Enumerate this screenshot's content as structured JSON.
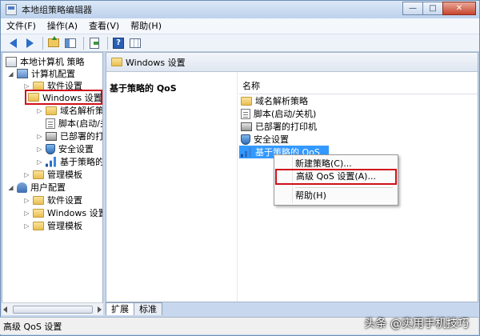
{
  "window": {
    "title": "本地组策略编辑器",
    "minimize": "—",
    "maximize": "□",
    "close": "✕"
  },
  "menu": [
    "文件(F)",
    "操作(A)",
    "查看(V)",
    "帮助(H)"
  ],
  "tree": {
    "root": "本地计算机 策略",
    "computer_config": "计算机配置",
    "software_settings": "软件设置",
    "windows_settings": "Windows 设置",
    "dns_policy": "域名解析策略",
    "scripts": "脚本(启动/关",
    "printers": "已部署的打印",
    "security": "安全设置",
    "qos": "基于策略的 C",
    "admin_templates": "管理模板",
    "user_config": "用户配置",
    "user_software": "软件设置",
    "user_windows": "Windows 设置",
    "user_admin_templates": "管理模板"
  },
  "right_pane": {
    "header": "Windows 设置",
    "left_title": "基于策略的 QoS",
    "column_name": "名称",
    "items": [
      "域名解析策略",
      "脚本(启动/关机)",
      "已部署的打印机",
      "安全设置",
      "基于策略的 QoS"
    ]
  },
  "context_menu": {
    "new_policy": "新建策略(C)...",
    "advanced_qos": "高级 QoS 设置(A)...",
    "help": "帮助(H)"
  },
  "tabs": [
    "扩展",
    "标准"
  ],
  "status": "高级 QoS 设置",
  "watermark": "头条 @实用手机技巧",
  "colors": {
    "highlight": "#d0101a",
    "selection": "#3399ff"
  }
}
